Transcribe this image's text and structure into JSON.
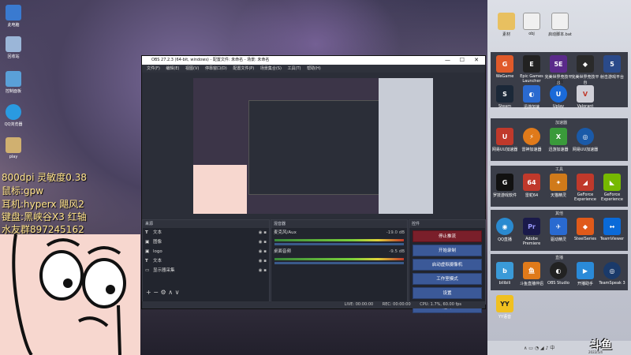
{
  "overlay": {
    "line1": "800dpi 灵敏度0.38",
    "line2": "鼠标:gpw",
    "line3": "耳机:hyperx 飓风2",
    "line4": "键盘:黑峡谷X3 红轴",
    "line5": "水友群897245162"
  },
  "desktop_icons": [
    {
      "label": "此电脑"
    },
    {
      "label": "回收站"
    },
    {
      "label": "控制面板"
    },
    {
      "label": "QQ浏览器"
    },
    {
      "label": "play"
    }
  ],
  "obs": {
    "title": "OBS 27.2.3 (64-bit, windows) - 配置文件: 未命名 - 场景: 未命名",
    "menu": [
      "文件(F)",
      "编辑(E)",
      "视图(V)",
      "停靠窗口(D)",
      "配置文件(P)",
      "场景集合(S)",
      "工具(T)",
      "帮助(H)"
    ],
    "sources_title": "来源",
    "sources": [
      {
        "icon": "T",
        "name": "文本"
      },
      {
        "icon": "▣",
        "name": "图像"
      },
      {
        "icon": "▣",
        "name": "logo"
      },
      {
        "icon": "T",
        "name": "文本"
      },
      {
        "icon": "▭",
        "name": "显示器采集"
      }
    ],
    "mixer_title": "混音器",
    "mixer": [
      {
        "name": "麦克风/Aux",
        "db": "-19.0 dB"
      },
      {
        "name": "桌面音频",
        "db": "-9.5 dB"
      }
    ],
    "controls_title": "控件",
    "controls": [
      "停止推流",
      "开始录制",
      "启动虚拟摄像机",
      "工作室模式",
      "设置",
      "退出"
    ],
    "status": {
      "live": "LIVE: 00:00:00",
      "rec": "REC: 00:00:00",
      "cpu": "CPU: 1.7%, 60.00 fps"
    }
  },
  "right_panel": {
    "section_top": "文件",
    "top_files": [
      "素材",
      "obj",
      "启动脚本.bat"
    ],
    "row1": [
      "WeGame",
      "Epic Games Launcher",
      "完美世界竞技平台",
      "完美世界竞技平台",
      "射击游戏平台"
    ],
    "section2": "游戏",
    "row2": [
      "Steam",
      "迅游加速",
      "Uplay",
      "Valorant"
    ],
    "section3": "加速器",
    "row3": [
      "网易UU加速器",
      "雷神加速器",
      "迅游加速器",
      "网易UU加速器"
    ],
    "section4": "工具",
    "row4": [
      "罗技游戏软件",
      "雷蛇64",
      "天猫精灵",
      "GeForce Experience",
      "GeForce Experience"
    ],
    "section5": "其他",
    "row5": [
      "QQ直播",
      "Adobe Premiere",
      "驱动精灵",
      "SteelSeries",
      "TeamViewer"
    ],
    "section6": "直播",
    "row6": [
      "bilibili",
      "斗鱼直播伴侣",
      "OBS Studio",
      "开播助手",
      "TeamSpeak 3"
    ],
    "row7": [
      "YY语音"
    ],
    "brand": "斗鱼",
    "date": "2022/5/4"
  }
}
